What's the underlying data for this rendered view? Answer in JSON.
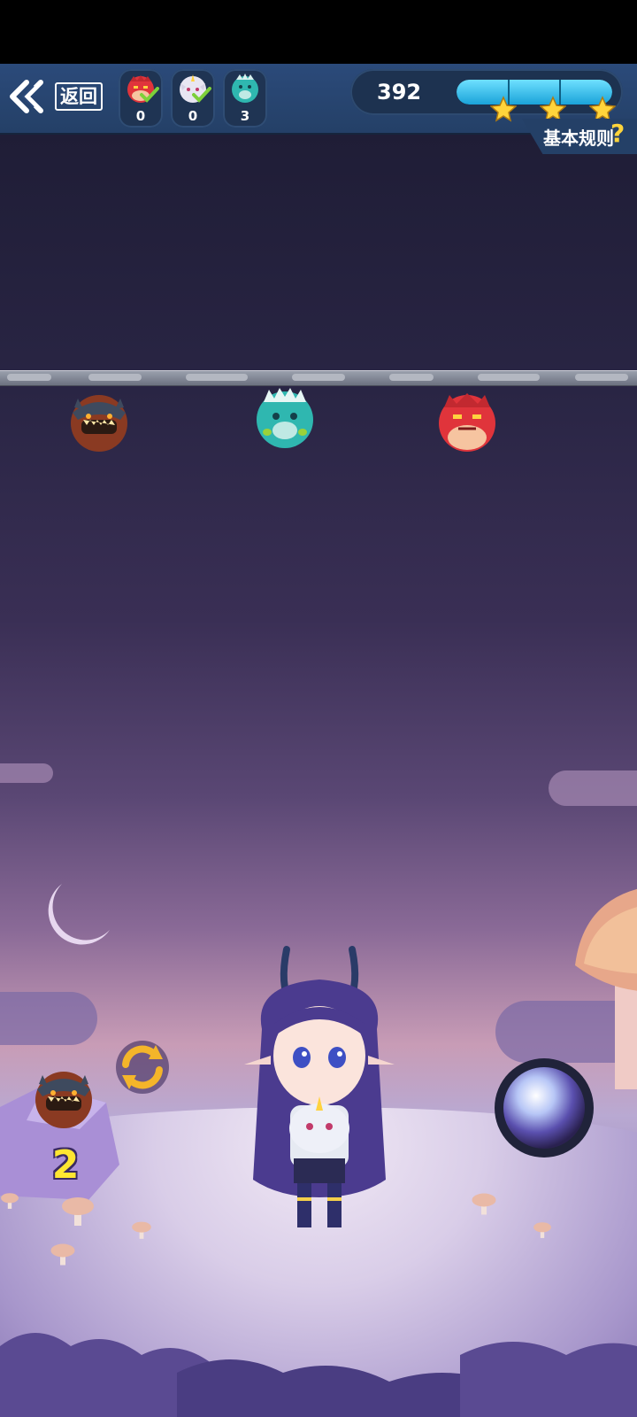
{
  "header": {
    "back_label": "返回",
    "score": "392",
    "progress_fraction": 1.0,
    "stars_earned": 3,
    "rules_label": "基本规则",
    "rules_icon": "?"
  },
  "monster_counters": [
    {
      "name": "red-dragon",
      "count": "0",
      "completed": true
    },
    {
      "name": "white-unicorn",
      "count": "0",
      "completed": true
    },
    {
      "name": "teal-monster",
      "count": "3",
      "completed": false
    }
  ],
  "hanging_monsters": [
    "dark-horned-monster",
    "teal-monster",
    "red-dragon"
  ],
  "launcher": {
    "next_monster": "dark-horned-monster",
    "ammo_count": "2",
    "swap_icon": "swap-arrows-icon",
    "fire_icon": "crystal-orb-icon"
  },
  "colors": {
    "hud": "#2b4a7a",
    "accent_blue": "#1aa3d9",
    "star": "#ffd43b",
    "ammo_text": "#ffe631"
  }
}
